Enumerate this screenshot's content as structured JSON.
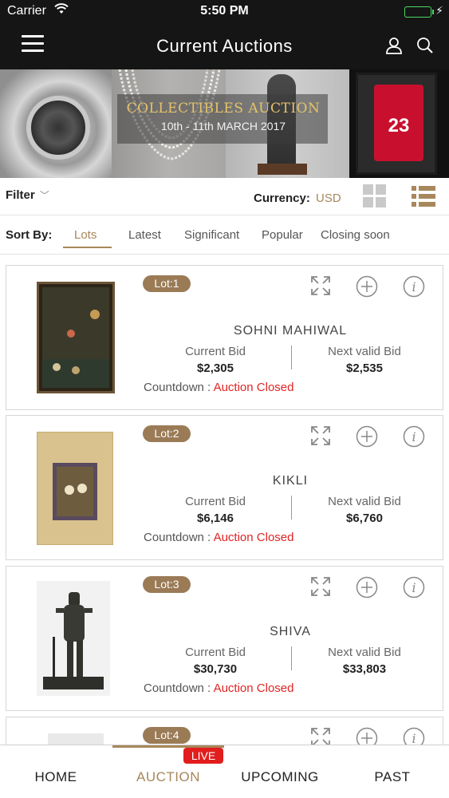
{
  "status_bar": {
    "carrier": "Carrier",
    "time": "5:50 PM"
  },
  "header": {
    "title": "Current Auctions"
  },
  "banner": {
    "title": "COLLECTIBLES AUCTION",
    "dates": "10th - 11th MARCH 2017",
    "jersey_number": "23"
  },
  "toolbar": {
    "filter_label": "Filter",
    "currency_label": "Currency:",
    "currency_value": "USD"
  },
  "sort": {
    "label": "Sort By:",
    "tabs": [
      "Lots",
      "Latest",
      "Significant",
      "Popular",
      "Closing soon"
    ],
    "active": "Lots"
  },
  "lots": [
    {
      "lot": "Lot:1",
      "name": "SOHNI MAHIWAL",
      "current_bid_label": "Current Bid",
      "current_bid": "$2,305",
      "next_bid_label": "Next valid Bid",
      "next_bid": "$2,535",
      "countdown_label": "Countdown :",
      "countdown_status": "Auction Closed"
    },
    {
      "lot": "Lot:2",
      "name": "KIKLI",
      "current_bid_label": "Current Bid",
      "current_bid": "$6,146",
      "next_bid_label": "Next valid Bid",
      "next_bid": "$6,760",
      "countdown_label": "Countdown :",
      "countdown_status": "Auction Closed"
    },
    {
      "lot": "Lot:3",
      "name": "SHIVA",
      "current_bid_label": "Current Bid",
      "current_bid": "$30,730",
      "next_bid_label": "Next valid Bid",
      "next_bid": "$33,803",
      "countdown_label": "Countdown :",
      "countdown_status": "Auction Closed"
    },
    {
      "lot": "Lot:4"
    }
  ],
  "bottom_nav": {
    "items": [
      "HOME",
      "AUCTION",
      "UPCOMING",
      "PAST"
    ],
    "active": "AUCTION",
    "live_badge": "LIVE"
  },
  "colors": {
    "accent": "#a7875b",
    "badge": "#9a7b56",
    "closed": "#e02424",
    "live": "#e11d1d",
    "header_bg": "#151515"
  }
}
